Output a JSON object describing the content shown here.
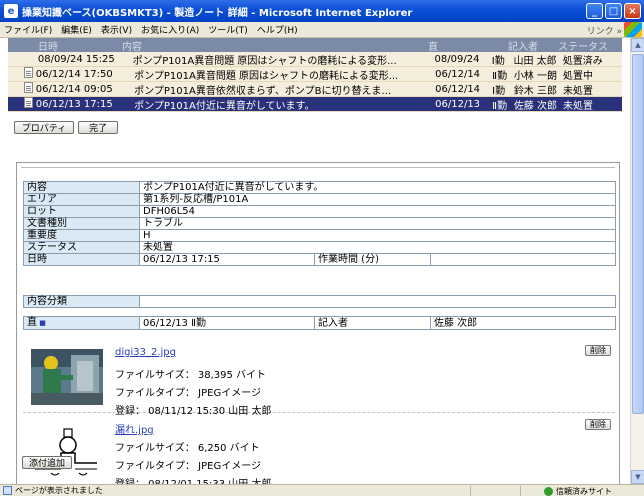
{
  "window": {
    "title": "操業知識ベース(OKBSMKT3) - 製造ノート 詳細 - Microsoft Internet Explorer",
    "buttons": {
      "minimize": "_",
      "maximize": "□",
      "close": "×"
    }
  },
  "menu": {
    "items": [
      "ファイル(F)",
      "編集(E)",
      "表示(V)",
      "お気に入り(A)",
      "ツール(T)",
      "ヘルプ(H)"
    ],
    "links_label": "リンク »"
  },
  "list": {
    "headers": {
      "date": "日時",
      "content": "内容",
      "workdate": "直",
      "author": "記入者",
      "status": "ステータス"
    },
    "rows": [
      {
        "date": "08/09/24 15:25",
        "content": "ポンプP101A異音問題 原因はシャフトの磨耗による変形...",
        "workdate": "08/09/24",
        "shift": "Ⅰ勤",
        "author": "山田 太郎",
        "status": "処置済み",
        "icon": "none"
      },
      {
        "date": "06/12/14 17:50",
        "content": "ポンプP101A異音問題 原因はシャフトの磨耗による変形...",
        "workdate": "06/12/14",
        "shift": "Ⅱ勤",
        "author": "小林 一朗",
        "status": "処置中",
        "icon": "note"
      },
      {
        "date": "06/12/14 09:05",
        "content": "ポンプP101A異音依然収まらず、ポンプBに切り替えま...",
        "workdate": "06/12/14",
        "shift": "Ⅰ勤",
        "author": "鈴木 三郎",
        "status": "未処置",
        "icon": "note"
      },
      {
        "date": "06/12/13 17:15",
        "content": "ポンプP101A付近に異音がしています。",
        "workdate": "06/12/13",
        "shift": "Ⅱ勤",
        "author": "佐藤 次郎",
        "status": "未処置",
        "icon": "doc",
        "selected": true
      }
    ]
  },
  "toolbar": {
    "properties_label": "プロパティ",
    "done_label": "完了"
  },
  "detail": {
    "fields": [
      {
        "label": "内容",
        "value": "ポンプP101A付近に異音がしています。"
      },
      {
        "label": "エリア",
        "value": "第1系列-反応槽/P101A"
      },
      {
        "label": "ロット",
        "value": "DFH06L54"
      },
      {
        "label": "文書種別",
        "value": "トラブル"
      },
      {
        "label": "重要度",
        "value": "H"
      },
      {
        "label": "ステータス",
        "value": "未処置"
      }
    ],
    "datetime_label": "日時",
    "datetime_value": "06/12/13 17:15",
    "worktime_label": "作業時間 (分)",
    "worktime_value": "",
    "category_label": "内容分類",
    "category_value": "",
    "shift_label": "直",
    "shift_value": "06/12/13 Ⅱ勤",
    "author_label": "記入者",
    "author_value": "佐藤 次郎"
  },
  "attachments": [
    {
      "name": "digi33_2.jpg",
      "size_line": "ファイルサイズ：  38,395  バイト",
      "type_line": "ファイルタイプ：  JPEGイメージ",
      "reg_line": "登録：  08/11/12 15:30  山田 太郎",
      "delete_label": "削除"
    },
    {
      "name": "漏れ.jpg",
      "size_line": "ファイルサイズ：  6,250  バイト",
      "type_line": "ファイルタイプ：  JPEGイメージ",
      "reg_line": "登録：  08/12/01 15:33  山田 太郎",
      "delete_label": "削除"
    }
  ],
  "add_attachment_label": "添付追加",
  "statusbar": {
    "message": "ページが表示されました",
    "zone": "信頼済みサイト"
  }
}
